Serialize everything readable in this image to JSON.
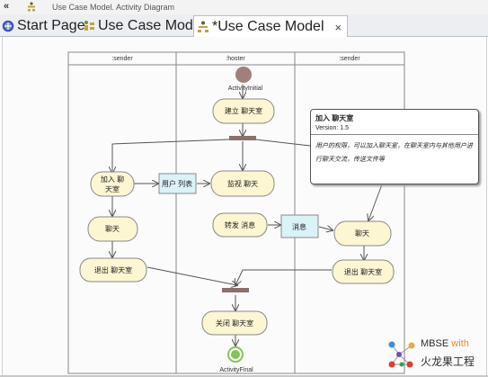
{
  "toolbar": {
    "chevron": "«",
    "breadcrumb": "Use Case Model.  Activity Diagram"
  },
  "tabs": [
    {
      "label": "Start Page",
      "icon": "start-page-icon"
    },
    {
      "label": "Use Case Model",
      "icon": "package-icon"
    },
    {
      "label": "*Use Case Model",
      "icon": "activity-diagram-icon",
      "close": "×"
    }
  ],
  "diagram": {
    "lanes": [
      ":sender",
      ":hoster",
      ":sender"
    ],
    "initial_label": "ActivityInitial",
    "final_label": "ActivityFinal",
    "activities": {
      "create_room": "建立 聊天室",
      "join_room_line1": "加入 聊",
      "join_room_line2": "天室",
      "monitor_chat": "监视 聊天",
      "forward_message": "转发 消息",
      "chat_left": "聊天",
      "exit_left": "退出 聊天室",
      "chat_right": "聊天",
      "exit_right": "退出 聊天室",
      "close_room": "关闭 聊天室"
    },
    "objects": {
      "user_list": "用户 列表",
      "message": "消息"
    }
  },
  "note": {
    "title": "加入 聊天室",
    "version": "Version: 1.5",
    "description": "用户的权限，可以加入聊天室，在聊天室内与其他用户进行聊天交流，传送文件等"
  },
  "logo": {
    "brand": "MBSE",
    "with": "with",
    "company": "火龙果工程"
  },
  "colors": {
    "activity_fill": "#fdf6d2",
    "object_fill": "#d9f3f7",
    "initial_node": "#a0807b",
    "final_node": "#86c25a",
    "accent": "#f08a24"
  }
}
